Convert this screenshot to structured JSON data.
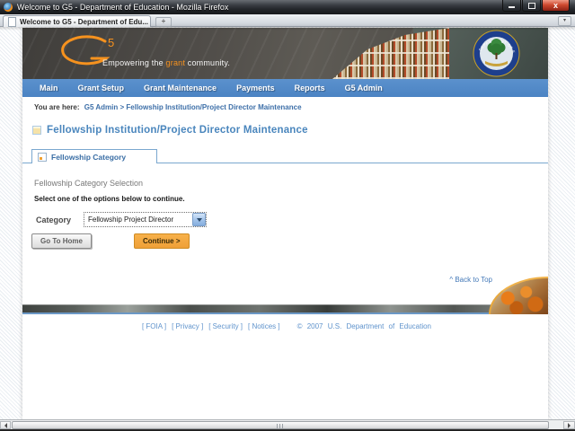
{
  "window": {
    "title": "Welcome to G5 - Department of Education - Mozilla Firefox",
    "tab_title": "Welcome to G5 - Department of Edu...",
    "new_tab_label": "+"
  },
  "header": {
    "logo_number": "5",
    "tagline_pre": "Empowering the ",
    "tagline_highlight": "grant",
    "tagline_post": " community.",
    "seal_text": "DEPARTMENT OF EDUCATION"
  },
  "nav": {
    "items": [
      "Main",
      "Grant Setup",
      "Grant Maintenance",
      "Payments",
      "Reports",
      "G5 Admin"
    ]
  },
  "breadcrumb": {
    "prefix": "You are here:",
    "path": "G5 Admin > Fellowship Institution/Project Director Maintenance"
  },
  "page": {
    "title": "Fellowship Institution/Project Director Maintenance",
    "tab_label": "Fellowship Category",
    "section_heading": "Fellowship Category Selection",
    "instruction": "Select one of the options below to continue.",
    "category_label": "Category",
    "category_value": "Fellowship Project Director",
    "go_home_label": "Go To Home",
    "continue_label": "Continue >",
    "back_to_top": "^ Back to Top"
  },
  "footer": {
    "links": [
      "[ FOIA ]",
      "[ Privacy ]",
      "[ Security ]",
      "[ Notices ]"
    ],
    "copyright": "© 2007 U.S. Department of Education"
  },
  "colors": {
    "nav_blue": "#4d86c4",
    "link_blue": "#3d6fa8",
    "accent_orange": "#f6921e",
    "footer_link_blue": "#5f93cc",
    "continue_button_orange": "#f2a643",
    "titlebar_dark": "#23262a"
  }
}
